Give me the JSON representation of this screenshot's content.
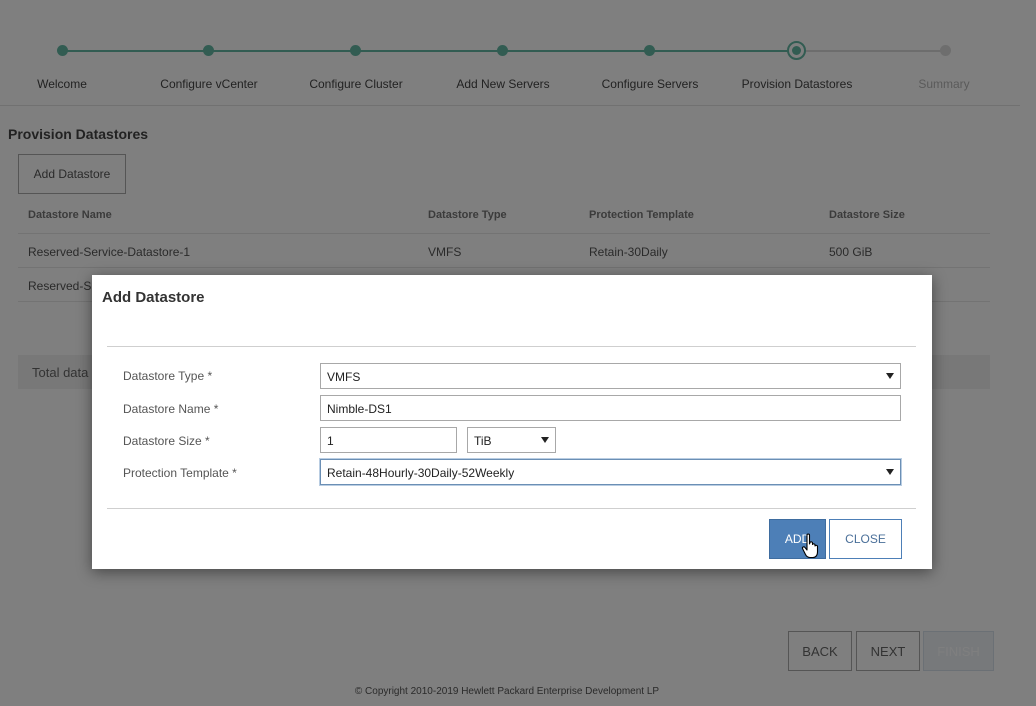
{
  "wizard": {
    "steps": [
      {
        "label": "Welcome",
        "state": "done"
      },
      {
        "label": "Configure vCenter",
        "state": "done"
      },
      {
        "label": "Configure Cluster",
        "state": "done"
      },
      {
        "label": "Add New Servers",
        "state": "done"
      },
      {
        "label": "Configure Servers",
        "state": "done"
      },
      {
        "label": "Provision Datastores",
        "state": "current"
      },
      {
        "label": "Summary",
        "state": "pending"
      }
    ]
  },
  "page": {
    "title": "Provision Datastores",
    "add_datastore_label": "Add Datastore",
    "total_label": "Total data"
  },
  "table": {
    "headers": [
      "Datastore Name",
      "Datastore Type",
      "Protection Template",
      "Datastore Size"
    ],
    "rows": [
      [
        "Reserved-Service-Datastore-1",
        "VMFS",
        "Retain-30Daily",
        "500 GiB"
      ],
      [
        "Reserved-S",
        "",
        "",
        ""
      ]
    ]
  },
  "footer": {
    "back_label": "BACK",
    "next_label": "NEXT",
    "finish_label": "FINISH",
    "copyright": "© Copyright 2010-2019 Hewlett Packard Enterprise Development LP"
  },
  "dialog": {
    "title": "Add Datastore",
    "type_label": "Datastore Type *",
    "type_value": "VMFS",
    "name_label": "Datastore Name *",
    "name_value": "Nimble-DS1",
    "size_label": "Datastore Size *",
    "size_value": "1",
    "size_unit": "TiB",
    "template_label": "Protection Template *",
    "template_value": "Retain-48Hourly-30Daily-52Weekly",
    "add_label": "ADD",
    "close_label": "CLOSE"
  },
  "colors": {
    "accent": "#64b9a5",
    "primary_button": "#4d7fb7"
  },
  "icons": {
    "cursor": "hand-pointer-icon",
    "select_arrow": "caret-down-icon"
  }
}
